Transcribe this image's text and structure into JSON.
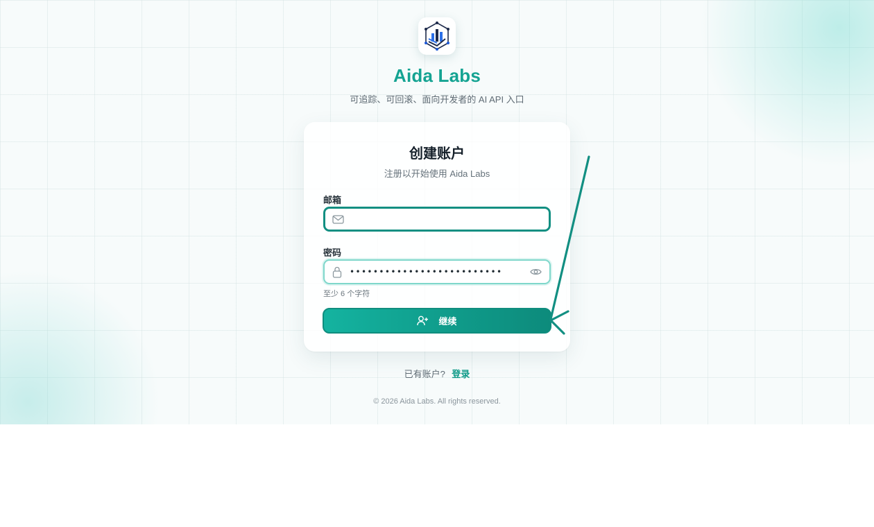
{
  "brand": {
    "name": "Aida Labs",
    "tagline": "可追踪、可回滚、面向开发者的 AI API 入口",
    "logo_icon": "aida-labs-logo"
  },
  "card": {
    "title": "创建账户",
    "subtitle": "注册以开始使用 Aida Labs"
  },
  "form": {
    "email": {
      "label": "邮箱",
      "value": "",
      "placeholder": "",
      "icon": "mail-icon"
    },
    "password": {
      "label": "密码",
      "masked_value": "••••••••••••••••••••••••••",
      "icon": "lock-icon",
      "toggle_icon": "eye-icon",
      "hint": "至少 6 个字符"
    },
    "submit": {
      "label": "继续",
      "icon": "user-plus-icon"
    }
  },
  "signin": {
    "prompt": "已有账户?",
    "link_label": "登录"
  },
  "footer": {
    "copyright": "© 2026 Aida Labs. All rights reserved."
  },
  "colors": {
    "brand_teal": "#14a392",
    "button_start": "#14b3a0",
    "button_end": "#0d8b7c",
    "focus_border": "#128f82",
    "annotation": "#128f82"
  }
}
